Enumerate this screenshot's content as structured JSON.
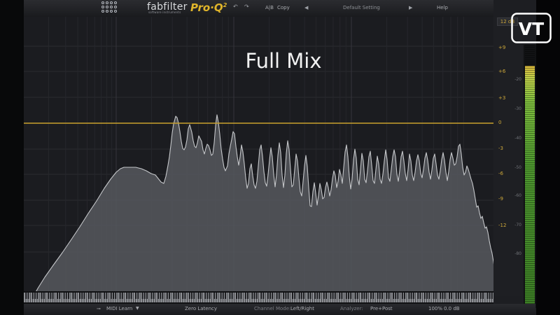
{
  "header": {
    "brand": "fabfilter",
    "brand_sub": "software instruments",
    "product": "Pro·Q",
    "product_version": "2",
    "undo_icon": "undo-icon",
    "redo_icon": "redo-icon",
    "ab_label": "A|B",
    "copy_label": "Copy",
    "prev_icon": "triangle-left-icon",
    "preset_name": "Default Setting",
    "next_icon": "triangle-right-icon",
    "help_label": "Help"
  },
  "overlay": {
    "title": "Full Mix"
  },
  "scale": {
    "range_label": "12 dB",
    "gain_labels": [
      "+9",
      "+6",
      "+3",
      "0",
      "-3",
      "-6",
      "-9",
      "-12"
    ],
    "db_labels": [
      "-20",
      "-30",
      "-40",
      "-50",
      "-60",
      "-70",
      "-80"
    ]
  },
  "meter": {
    "level_fraction": 0.92
  },
  "footer": {
    "midi_learn": "MIDI Learn",
    "latency": "Zero Latency",
    "channel_mode_label": "Channel Mode:",
    "channel_mode_value": "Left/Right",
    "analyzer_label": "Analyzer:",
    "analyzer_value": "Pre+Post",
    "zoom": "100%",
    "output_gain": "0.0 dB"
  },
  "watermark": {
    "letters": "VT"
  },
  "colors": {
    "eq_line": "#c9a12e",
    "spectrum_fill": "#5c5e64",
    "spectrum_line": "#c8cacd",
    "meter_green": "#4f9a2f"
  }
}
